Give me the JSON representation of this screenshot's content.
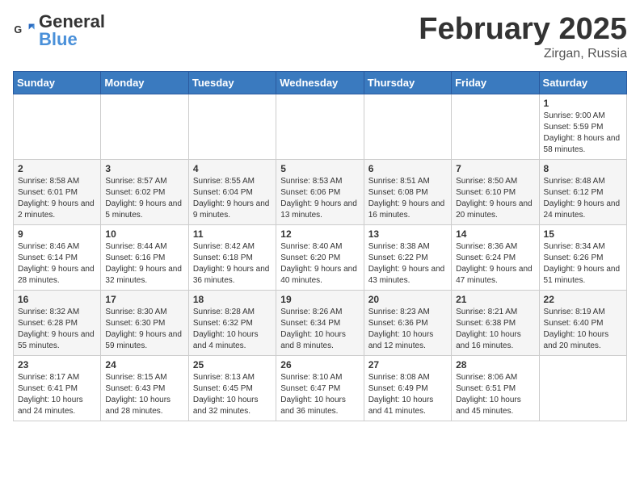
{
  "header": {
    "logo_general": "General",
    "logo_blue": "Blue",
    "month_title": "February 2025",
    "location": "Zirgan, Russia"
  },
  "weekdays": [
    "Sunday",
    "Monday",
    "Tuesday",
    "Wednesday",
    "Thursday",
    "Friday",
    "Saturday"
  ],
  "weeks": [
    [
      {
        "day": "",
        "info": ""
      },
      {
        "day": "",
        "info": ""
      },
      {
        "day": "",
        "info": ""
      },
      {
        "day": "",
        "info": ""
      },
      {
        "day": "",
        "info": ""
      },
      {
        "day": "",
        "info": ""
      },
      {
        "day": "1",
        "info": "Sunrise: 9:00 AM\nSunset: 5:59 PM\nDaylight: 8 hours\nand 58 minutes."
      }
    ],
    [
      {
        "day": "2",
        "info": "Sunrise: 8:58 AM\nSunset: 6:01 PM\nDaylight: 9 hours\nand 2 minutes."
      },
      {
        "day": "3",
        "info": "Sunrise: 8:57 AM\nSunset: 6:02 PM\nDaylight: 9 hours\nand 5 minutes."
      },
      {
        "day": "4",
        "info": "Sunrise: 8:55 AM\nSunset: 6:04 PM\nDaylight: 9 hours\nand 9 minutes."
      },
      {
        "day": "5",
        "info": "Sunrise: 8:53 AM\nSunset: 6:06 PM\nDaylight: 9 hours\nand 13 minutes."
      },
      {
        "day": "6",
        "info": "Sunrise: 8:51 AM\nSunset: 6:08 PM\nDaylight: 9 hours\nand 16 minutes."
      },
      {
        "day": "7",
        "info": "Sunrise: 8:50 AM\nSunset: 6:10 PM\nDaylight: 9 hours\nand 20 minutes."
      },
      {
        "day": "8",
        "info": "Sunrise: 8:48 AM\nSunset: 6:12 PM\nDaylight: 9 hours\nand 24 minutes."
      }
    ],
    [
      {
        "day": "9",
        "info": "Sunrise: 8:46 AM\nSunset: 6:14 PM\nDaylight: 9 hours\nand 28 minutes."
      },
      {
        "day": "10",
        "info": "Sunrise: 8:44 AM\nSunset: 6:16 PM\nDaylight: 9 hours\nand 32 minutes."
      },
      {
        "day": "11",
        "info": "Sunrise: 8:42 AM\nSunset: 6:18 PM\nDaylight: 9 hours\nand 36 minutes."
      },
      {
        "day": "12",
        "info": "Sunrise: 8:40 AM\nSunset: 6:20 PM\nDaylight: 9 hours\nand 40 minutes."
      },
      {
        "day": "13",
        "info": "Sunrise: 8:38 AM\nSunset: 6:22 PM\nDaylight: 9 hours\nand 43 minutes."
      },
      {
        "day": "14",
        "info": "Sunrise: 8:36 AM\nSunset: 6:24 PM\nDaylight: 9 hours\nand 47 minutes."
      },
      {
        "day": "15",
        "info": "Sunrise: 8:34 AM\nSunset: 6:26 PM\nDaylight: 9 hours\nand 51 minutes."
      }
    ],
    [
      {
        "day": "16",
        "info": "Sunrise: 8:32 AM\nSunset: 6:28 PM\nDaylight: 9 hours\nand 55 minutes."
      },
      {
        "day": "17",
        "info": "Sunrise: 8:30 AM\nSunset: 6:30 PM\nDaylight: 9 hours\nand 59 minutes."
      },
      {
        "day": "18",
        "info": "Sunrise: 8:28 AM\nSunset: 6:32 PM\nDaylight: 10 hours\nand 4 minutes."
      },
      {
        "day": "19",
        "info": "Sunrise: 8:26 AM\nSunset: 6:34 PM\nDaylight: 10 hours\nand 8 minutes."
      },
      {
        "day": "20",
        "info": "Sunrise: 8:23 AM\nSunset: 6:36 PM\nDaylight: 10 hours\nand 12 minutes."
      },
      {
        "day": "21",
        "info": "Sunrise: 8:21 AM\nSunset: 6:38 PM\nDaylight: 10 hours\nand 16 minutes."
      },
      {
        "day": "22",
        "info": "Sunrise: 8:19 AM\nSunset: 6:40 PM\nDaylight: 10 hours\nand 20 minutes."
      }
    ],
    [
      {
        "day": "23",
        "info": "Sunrise: 8:17 AM\nSunset: 6:41 PM\nDaylight: 10 hours\nand 24 minutes."
      },
      {
        "day": "24",
        "info": "Sunrise: 8:15 AM\nSunset: 6:43 PM\nDaylight: 10 hours\nand 28 minutes."
      },
      {
        "day": "25",
        "info": "Sunrise: 8:13 AM\nSunset: 6:45 PM\nDaylight: 10 hours\nand 32 minutes."
      },
      {
        "day": "26",
        "info": "Sunrise: 8:10 AM\nSunset: 6:47 PM\nDaylight: 10 hours\nand 36 minutes."
      },
      {
        "day": "27",
        "info": "Sunrise: 8:08 AM\nSunset: 6:49 PM\nDaylight: 10 hours\nand 41 minutes."
      },
      {
        "day": "28",
        "info": "Sunrise: 8:06 AM\nSunset: 6:51 PM\nDaylight: 10 hours\nand 45 minutes."
      },
      {
        "day": "",
        "info": ""
      }
    ]
  ]
}
